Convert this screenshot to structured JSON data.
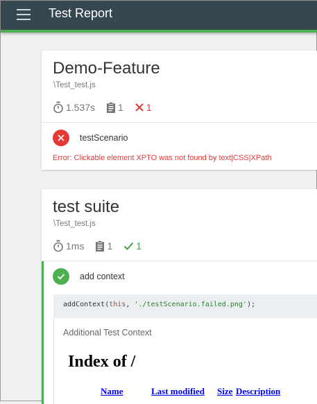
{
  "header": {
    "title": "Test Report"
  },
  "colors": {
    "header_bg": "#37474f",
    "accent_green": "#4caf50",
    "fail_red": "#e53935"
  },
  "suites": [
    {
      "title": "Demo-Feature",
      "file": "\\Test_test.js",
      "duration": "1.537s",
      "test_count": "1",
      "result_count": "1",
      "result_icon": "x-fail-icon",
      "tests": [
        {
          "name": "testScenario",
          "status": "failed",
          "error": "Error: Clickable element XPTO was not found by text|CSS|XPath"
        }
      ]
    },
    {
      "title": "test suite",
      "file": "\\Test_test.js",
      "duration": "1ms",
      "test_count": "1",
      "result_count": "1",
      "result_icon": "check-pass-icon",
      "tests": [
        {
          "name": "add context",
          "status": "passed",
          "code": {
            "fn": "addContext(",
            "kw": "this",
            "sep": ", ",
            "str": "'./testScenario.failed.png'",
            "end": ");"
          },
          "context_label": "Additional Test Context",
          "context_page": {
            "title": "Index of /",
            "columns": [
              "Name",
              "Last modified",
              "Size",
              "Description"
            ]
          }
        }
      ]
    }
  ]
}
